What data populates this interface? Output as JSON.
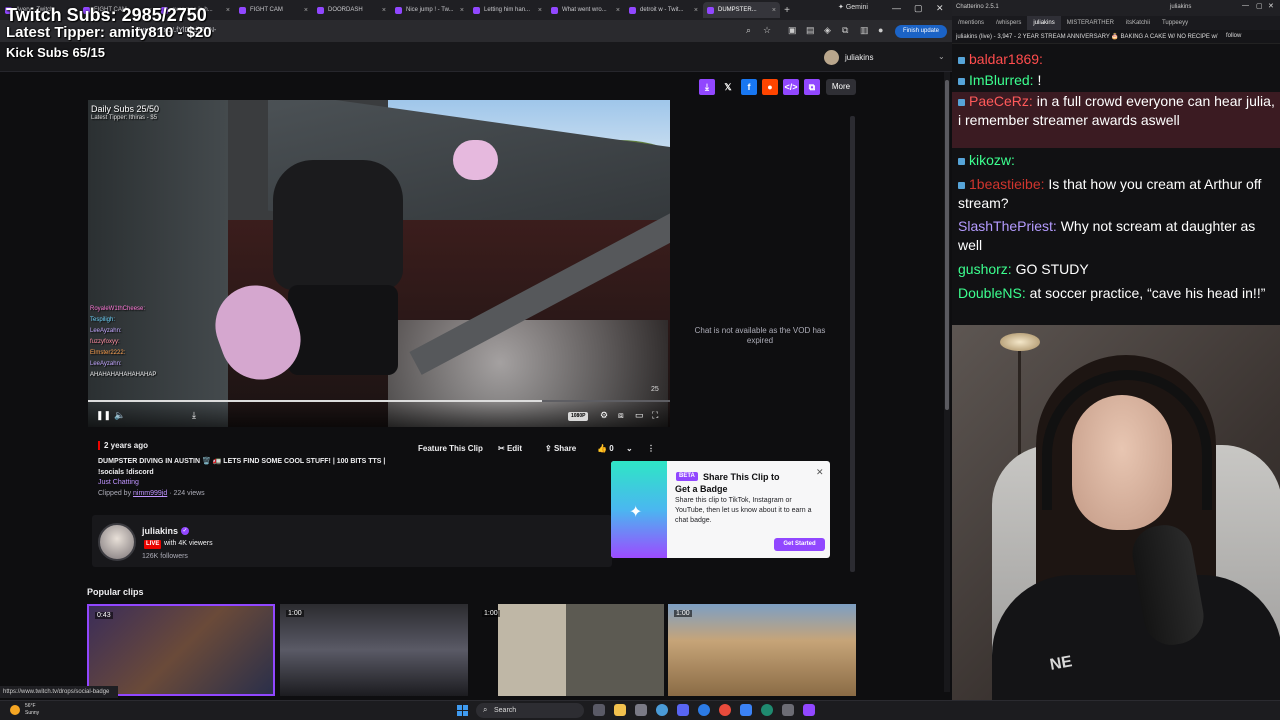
{
  "browser": {
    "tabs": [
      {
        "label": "Avery - Twitch"
      },
      {
        "label": "FIGHT CAM"
      },
      {
        "label": "everyone is h..."
      },
      {
        "label": "FIGHT CAM"
      },
      {
        "label": "DOORDASH"
      },
      {
        "label": "Nice jump ! - Tw..."
      },
      {
        "label": "Letting him han..."
      },
      {
        "label": "What went wro..."
      },
      {
        "label": "detroit w - Twit..."
      },
      {
        "label": "DUMPSTER..."
      }
    ],
    "new_tab": "+",
    "gemini": "Gemini",
    "url": "...Purple-CxOLfYlDZdlGTN-",
    "finish_update": "Finish update",
    "status_url": "https://www.twitch.tv/drops/social-badge"
  },
  "overlay": {
    "subs": "Twitch Subs: 2985/2750",
    "tipper": "Latest Tipper: amity810 - $20",
    "kick": "Kick Subs 65/15"
  },
  "twitch": {
    "username": "juliakins",
    "more_label": "More",
    "chat_unavailable": "Chat is not available as the VOD has expired"
  },
  "video": {
    "daily_subs": "Daily Subs 25/50",
    "latest_tipper": "Latest Tipper: lthiras - $5",
    "count": "25",
    "progress_fraction": 0.78,
    "quality": "1080P",
    "chat_lines": [
      {
        "name": "RoyaleW1thCheese:",
        "text": "",
        "color": "#ff7ad9"
      },
      {
        "name": "Tespiligh:",
        "text": "",
        "color": "#6fd7ff"
      },
      {
        "name": "LeeAyzahn:",
        "text": "",
        "color": "#c2a6ff"
      },
      {
        "name": "fuzzyfoxyy:",
        "text": "",
        "color": "#ff8ba0"
      },
      {
        "name": "Elmster2222:",
        "text": "",
        "color": "#ffa04d"
      },
      {
        "name": "LeeAyzahn:",
        "text": "",
        "color": "#c2a6ff"
      },
      {
        "name": "",
        "text": "AHAHAHAHAHAHAHAP",
        "color": "#ffffff"
      }
    ]
  },
  "clip": {
    "age": "2 years ago",
    "title": "DUMPSTER DIVING IN AUSTIN 🗑️ 🚛 LETS FIND SOME COOL STUFF! | 100 BITS TTS | !socials !discord",
    "category": "Just Chatting",
    "clipped_by_prefix": "Clipped by",
    "clipped_by_user": "nimm999jd",
    "views": "· 224 views",
    "feature": "Feature This Clip",
    "edit": "Edit",
    "share": "Share",
    "likes": "0"
  },
  "channel": {
    "name": "juliakins",
    "live": "LIVE",
    "viewers": "with 4K viewers",
    "followers": "126K followers"
  },
  "badge_popup": {
    "beta": "BETA",
    "title": "Share This Clip to Get a Badge",
    "description": "Share this clip to TikTok, Instagram or YouTube, then let us know about it to earn a chat badge.",
    "cta": "Get Started"
  },
  "popular": {
    "title": "Popular clips",
    "clips": [
      {
        "duration": "0:43"
      },
      {
        "duration": "1:00"
      },
      {
        "duration": "1:00"
      },
      {
        "duration": "1:00"
      }
    ]
  },
  "chatterino": {
    "title": "Chatterino 2.5.1",
    "user": "juliakins",
    "tabs": [
      "/mentions",
      "/whispers",
      "juliakins",
      "MISTERARTHER",
      "itsKatchii",
      "Tuppeeyy"
    ],
    "header": "juliakins (live) - 3,947 - 2 YEAR STREAM ANNIVERSARY 🎂 BAKING A CAKE W/ NO RECIPE w/",
    "follow": "follow",
    "messages": [
      {
        "name": "baldar1869:",
        "text": "",
        "color": "#ff4d4d"
      },
      {
        "name": "ImBlurred:",
        "text": "!",
        "color": "#3cff8f"
      },
      {
        "name": "PaeCeRz:",
        "text": "in a full crowd everyone can hear julia, i remember streamer awards aswell",
        "color": "#ff5a5a"
      },
      {
        "name": "kikozw:",
        "text": "",
        "color": "#3cff8f"
      },
      {
        "name": "1beastieibe:",
        "text": "Is that how you cream at Arthur off stream?",
        "color": "#d0352e"
      },
      {
        "name": "SlashThePriest:",
        "text": "Why not scream at daughter as well",
        "color": "#b49bff"
      },
      {
        "name": "gushorz:",
        "text": "GO STUDY",
        "color": "#3cff8f"
      },
      {
        "name": "DoubleNS:",
        "text": "at soccer practice, “cave his head in!!”",
        "color": "#3cff8f"
      }
    ]
  },
  "webcam": {
    "shirt_text": "NE"
  },
  "taskbar": {
    "temp": "56°F",
    "weather": "Sunny",
    "search": "Search"
  },
  "colors": {
    "twitch_purple": "#9147ff",
    "live_red": "#eb0400",
    "background": "#0e0e10"
  }
}
